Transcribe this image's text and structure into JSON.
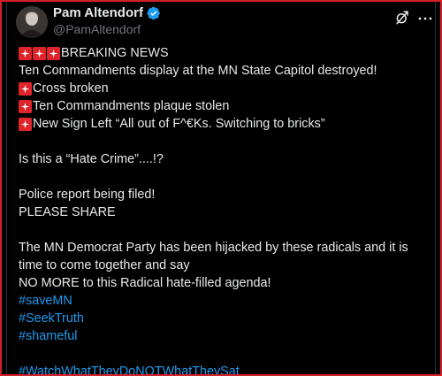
{
  "author": {
    "name": "Pam Altendorf",
    "handle": "@PamAltendorf"
  },
  "icons": {
    "verified": "verified-badge-icon",
    "grok": "grok-icon",
    "more": "more-icon",
    "siren": "police-siren-icon"
  },
  "colors": {
    "background": "#000000",
    "text": "#e7e9ea",
    "muted": "#71767b",
    "link": "#1d9bf0",
    "verified": "#1d9bf0",
    "siren": "#e0242b",
    "frame": "#d5202a"
  },
  "post": {
    "line1": "BREAKING NEWS",
    "line2": "Ten Commandments display at the MN State Capitol destroyed!",
    "line3": "Cross broken",
    "line4": "Ten Commandments plaque stolen",
    "line5": "New Sign Left “All out of F^€Ks. Switching to bricks”",
    "line6": "Is this a “Hate Crime”....!?",
    "line7": "Police report being filed!",
    "line8": "PLEASE SHARE",
    "line9": "The MN Democrat Party has been hijacked by these radicals and it is time to come together and say",
    "line10": "NO MORE to this Radical hate-filled agenda!",
    "hashtags": [
      "#saveMN",
      "#SeekTruth",
      "#shameful"
    ],
    "final_hashtag": "#WatchWhatTheyDoNOTWhatTheySat"
  }
}
